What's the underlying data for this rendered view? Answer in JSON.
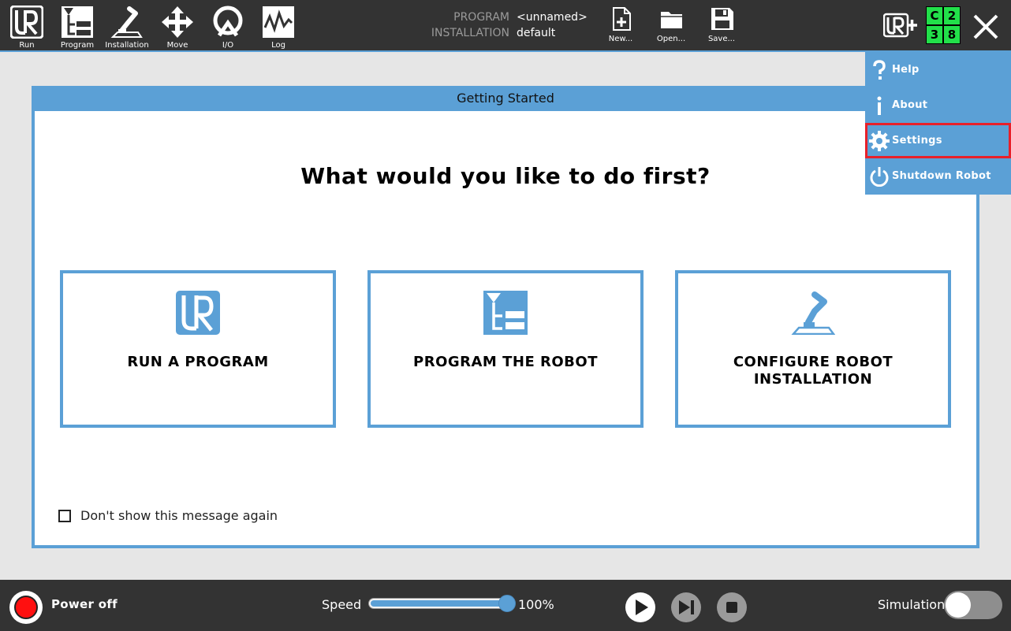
{
  "nav": [
    {
      "id": "run",
      "label": "Run",
      "icon": "ur-logo-icon"
    },
    {
      "id": "program",
      "label": "Program",
      "icon": "program-tree-icon"
    },
    {
      "id": "installation",
      "label": "Installation",
      "icon": "robot-arm-icon"
    },
    {
      "id": "move",
      "label": "Move",
      "icon": "move-arrows-icon"
    },
    {
      "id": "io",
      "label": "I/O",
      "icon": "io-icon"
    },
    {
      "id": "log",
      "label": "Log",
      "icon": "log-icon"
    }
  ],
  "program_info": {
    "program_key": "PROGRAM",
    "program_value": "<unnamed>",
    "installation_key": "INSTALLATION",
    "installation_value": "default"
  },
  "file_actions": {
    "new": "New...",
    "open": "Open...",
    "save": "Save..."
  },
  "status_grid": {
    "c": "C",
    "n1": "2",
    "n2": "3",
    "n3": "8",
    "color": "#22e04a"
  },
  "dialog": {
    "title": "Getting Started",
    "question": "What would you like to do first?",
    "choices": [
      {
        "label": "RUN A PROGRAM",
        "icon": "ur-logo-icon"
      },
      {
        "label": "PROGRAM THE ROBOT",
        "icon": "program-tree-icon"
      },
      {
        "label": "CONFIGURE ROBOT INSTALLATION",
        "icon": "robot-arm-icon"
      }
    ],
    "dont_show_label": "Don't show this message again",
    "dont_show_checked": false
  },
  "menu": {
    "items": [
      {
        "label": "Help",
        "icon": "help-icon"
      },
      {
        "label": "About",
        "icon": "info-icon"
      },
      {
        "label": "Settings",
        "icon": "gear-icon",
        "highlighted": true
      },
      {
        "label": "Shutdown Robot",
        "icon": "power-icon"
      }
    ]
  },
  "bottom": {
    "power_label": "Power off",
    "speed_label": "Speed",
    "speed_value": "100%",
    "speed_percent": 100,
    "simulation_label": "Simulation",
    "simulation_on": false
  },
  "colors": {
    "accent": "#5ba0d6",
    "bar": "#333333",
    "highlight": "#e8202a",
    "power": "#ff1010"
  }
}
